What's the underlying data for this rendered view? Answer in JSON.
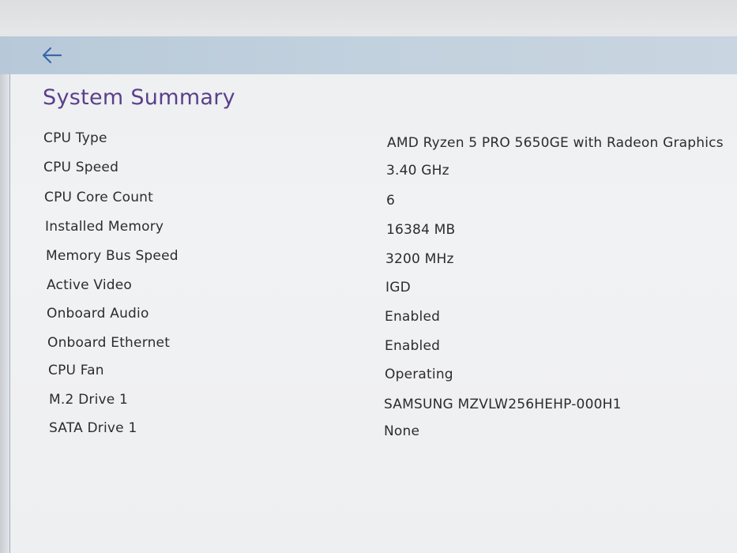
{
  "header": {
    "back_icon": "arrow-left-icon"
  },
  "page": {
    "title": "System Summary"
  },
  "rows": [
    {
      "label": "CPU Type",
      "value": "AMD Ryzen 5 PRO 5650GE with Radeon Graphics"
    },
    {
      "label": "CPU Speed",
      "value": "3.40 GHz"
    },
    {
      "label": "CPU Core Count",
      "value": "6"
    },
    {
      "label": "Installed Memory",
      "value": "16384 MB"
    },
    {
      "label": "Memory Bus Speed",
      "value": "3200 MHz"
    },
    {
      "label": "Active Video",
      "value": "IGD"
    },
    {
      "label": "Onboard Audio",
      "value": "Enabled"
    },
    {
      "label": "Onboard Ethernet",
      "value": "Enabled"
    },
    {
      "label": "CPU Fan",
      "value": "Operating"
    },
    {
      "label": "M.2 Drive 1",
      "value": "SAMSUNG MZVLW256HEHP-000H1"
    },
    {
      "label": "SATA Drive 1",
      "value": "None"
    }
  ],
  "colors": {
    "title": "#5b3f8a",
    "header_bar": "#bfcfdd",
    "text": "#2c2c2e",
    "accent_blue": "#3a67a8"
  }
}
